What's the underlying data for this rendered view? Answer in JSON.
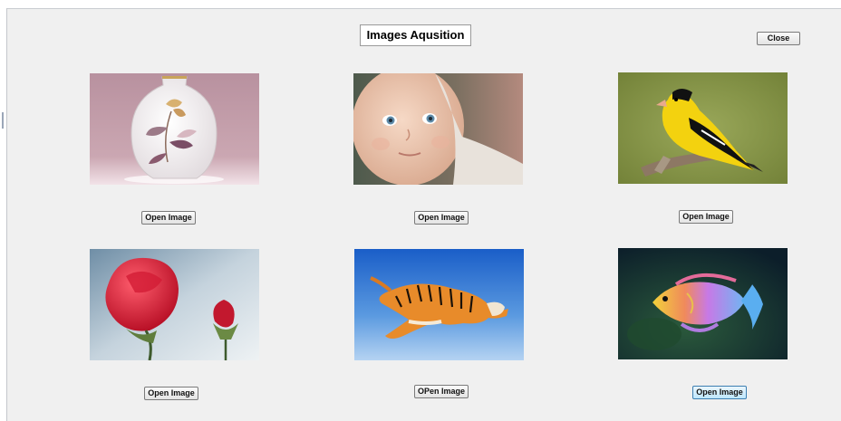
{
  "window": {
    "title": "Images Aqusition",
    "close_label": "Close"
  },
  "images": [
    {
      "subject": "vase",
      "button_label": "Open Image"
    },
    {
      "subject": "baby",
      "button_label": "Open Image"
    },
    {
      "subject": "bird",
      "button_label": "Open Image"
    },
    {
      "subject": "rose",
      "button_label": "Open Image"
    },
    {
      "subject": "tiger",
      "button_label": "OPen Image"
    },
    {
      "subject": "fish",
      "button_label": "Open Image"
    }
  ],
  "focused_button": "fish"
}
